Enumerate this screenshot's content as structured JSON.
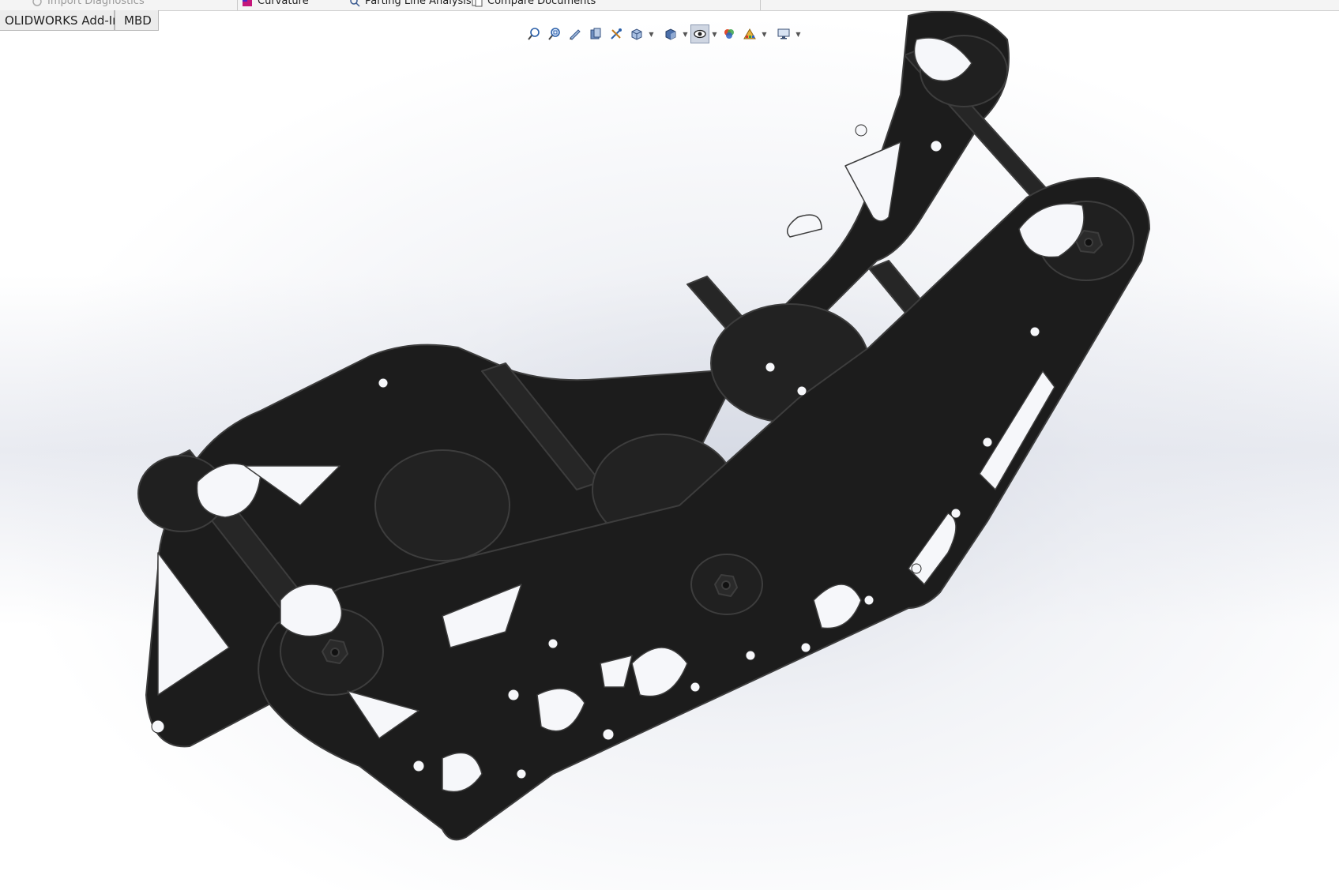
{
  "ribbon": {
    "items": [
      {
        "label": "Import Diagnostics",
        "state": "disabled"
      },
      {
        "label": "Curvature",
        "state": "normal"
      },
      {
        "label": "Parting Line Analysis",
        "state": "normal"
      },
      {
        "label": "Compare Documents",
        "state": "normal"
      }
    ]
  },
  "tabs": [
    {
      "label": "OLIDWORKS Add-Ins"
    },
    {
      "label": "MBD"
    }
  ],
  "heads_up_toolbar": {
    "icons": [
      "zoom-to-fit-icon",
      "zoom-to-area-icon",
      "previous-view-icon",
      "section-view-icon",
      "dynamic-annotation-icon",
      "view-orientation-icon",
      "display-style-icon",
      "hide-show-items-icon",
      "edit-appearance-icon",
      "apply-scene-icon",
      "view-settings-icon"
    ],
    "active": "hide-show-items-icon"
  },
  "viewport": {
    "model": "robot-chassis-assembly",
    "model_color": "#1c1c1c",
    "background": "gradient-white-grey"
  },
  "colors": {
    "ribbon_bg": "#f4f4f4",
    "tab_bg": "#ececec",
    "model_edge": "#3a3a3a",
    "active_toggle": "#cfd6e2"
  }
}
